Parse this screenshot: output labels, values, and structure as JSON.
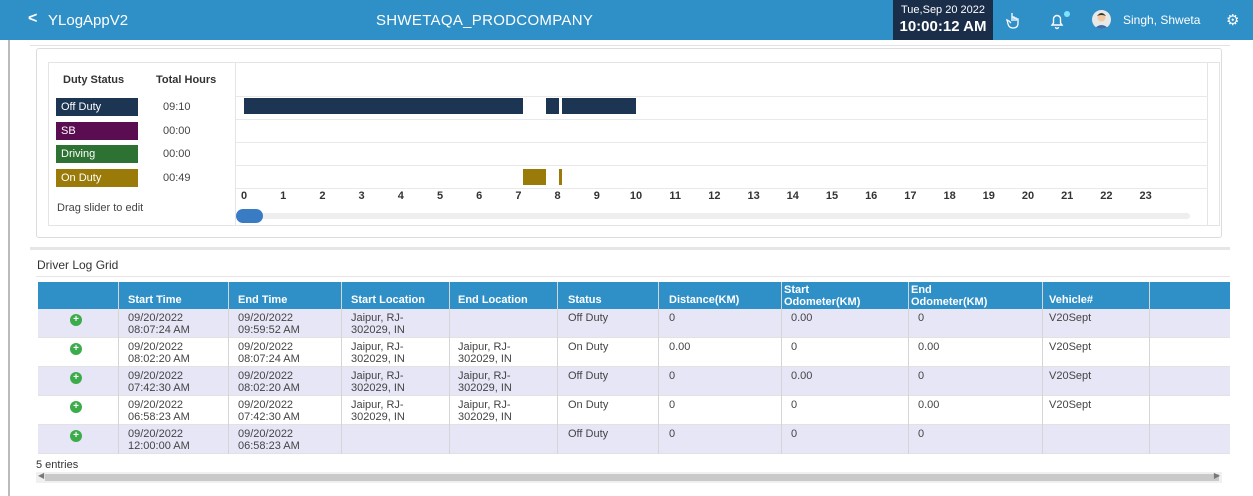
{
  "header": {
    "back": "<",
    "app_name": "YLogAppV2",
    "company": "SHWETAQA_PRODCOMPANY",
    "date": "Tue,Sep 20 2022",
    "time": "10:00:12 AM",
    "user": "Singh, Shweta"
  },
  "duty_panel": {
    "col_status": "Duty Status",
    "col_hours": "Total Hours",
    "rows": [
      {
        "status": "Off Duty",
        "hours": "09:10",
        "color": "#1b3553"
      },
      {
        "status": "SB",
        "hours": "00:00",
        "color": "#5b0d52"
      },
      {
        "status": "Driving",
        "hours": "00:00",
        "color": "#2e7233"
      },
      {
        "status": "On Duty",
        "hours": "00:49",
        "color": "#9a7b0a"
      }
    ],
    "drag_hint": "Drag slider to edit",
    "hours": [
      "0",
      "1",
      "2",
      "3",
      "4",
      "5",
      "6",
      "7",
      "8",
      "9",
      "10",
      "11",
      "12",
      "13",
      "14",
      "15",
      "16",
      "17",
      "18",
      "19",
      "20",
      "21",
      "22",
      "23"
    ],
    "segments": [
      {
        "row": 0,
        "start": 0.0,
        "end": 7.13
      },
      {
        "row": 0,
        "start": 7.71,
        "end": 8.04
      },
      {
        "row": 0,
        "start": 8.12,
        "end": 10.0
      },
      {
        "row": 3,
        "start": 7.13,
        "end": 7.71
      },
      {
        "row": 3,
        "start": 8.04,
        "end": 8.12
      }
    ]
  },
  "grid": {
    "title": "Driver Log Grid",
    "columns": [
      "",
      "Start Time",
      "End Time",
      "Start Location",
      "End Location",
      "Status",
      "Distance(KM)",
      "Start Odometer(KM)",
      "End Odometer(KM)",
      "Vehicle#",
      ""
    ],
    "rows": [
      {
        "start_date": "09/20/2022",
        "start_time": "08:07:24 AM",
        "end_date": "09/20/2022",
        "end_time": "09:59:52 AM",
        "start_loc1": "Jaipur, RJ-",
        "start_loc2": "302029, IN",
        "end_loc1": "",
        "end_loc2": "",
        "status": "Off Duty",
        "distance": "0",
        "start_odo": "0.00",
        "end_odo": "0",
        "vehicle": "V20Sept"
      },
      {
        "start_date": "09/20/2022",
        "start_time": "08:02:20 AM",
        "end_date": "09/20/2022",
        "end_time": "08:07:24 AM",
        "start_loc1": "Jaipur, RJ-",
        "start_loc2": "302029, IN",
        "end_loc1": "Jaipur, RJ-",
        "end_loc2": "302029, IN",
        "status": "On Duty",
        "distance": "0.00",
        "start_odo": "0",
        "end_odo": "0.00",
        "vehicle": "V20Sept"
      },
      {
        "start_date": "09/20/2022",
        "start_time": "07:42:30 AM",
        "end_date": "09/20/2022",
        "end_time": "08:02:20 AM",
        "start_loc1": "Jaipur, RJ-",
        "start_loc2": "302029, IN",
        "end_loc1": "Jaipur, RJ-",
        "end_loc2": "302029, IN",
        "status": "Off Duty",
        "distance": "0",
        "start_odo": "0.00",
        "end_odo": "0",
        "vehicle": "V20Sept"
      },
      {
        "start_date": "09/20/2022",
        "start_time": "06:58:23 AM",
        "end_date": "09/20/2022",
        "end_time": "07:42:30 AM",
        "start_loc1": "Jaipur, RJ-",
        "start_loc2": "302029, IN",
        "end_loc1": "Jaipur, RJ-",
        "end_loc2": "302029, IN",
        "status": "On Duty",
        "distance": "0",
        "start_odo": "0",
        "end_odo": "0.00",
        "vehicle": "V20Sept"
      },
      {
        "start_date": "09/20/2022",
        "start_time": "12:00:00 AM",
        "end_date": "09/20/2022",
        "end_time": "06:58:23 AM",
        "start_loc1": "",
        "start_loc2": "",
        "end_loc1": "",
        "end_loc2": "",
        "status": "Off Duty",
        "distance": "0",
        "start_odo": "0",
        "end_odo": "0",
        "vehicle": ""
      }
    ],
    "entries": "5 entries"
  }
}
